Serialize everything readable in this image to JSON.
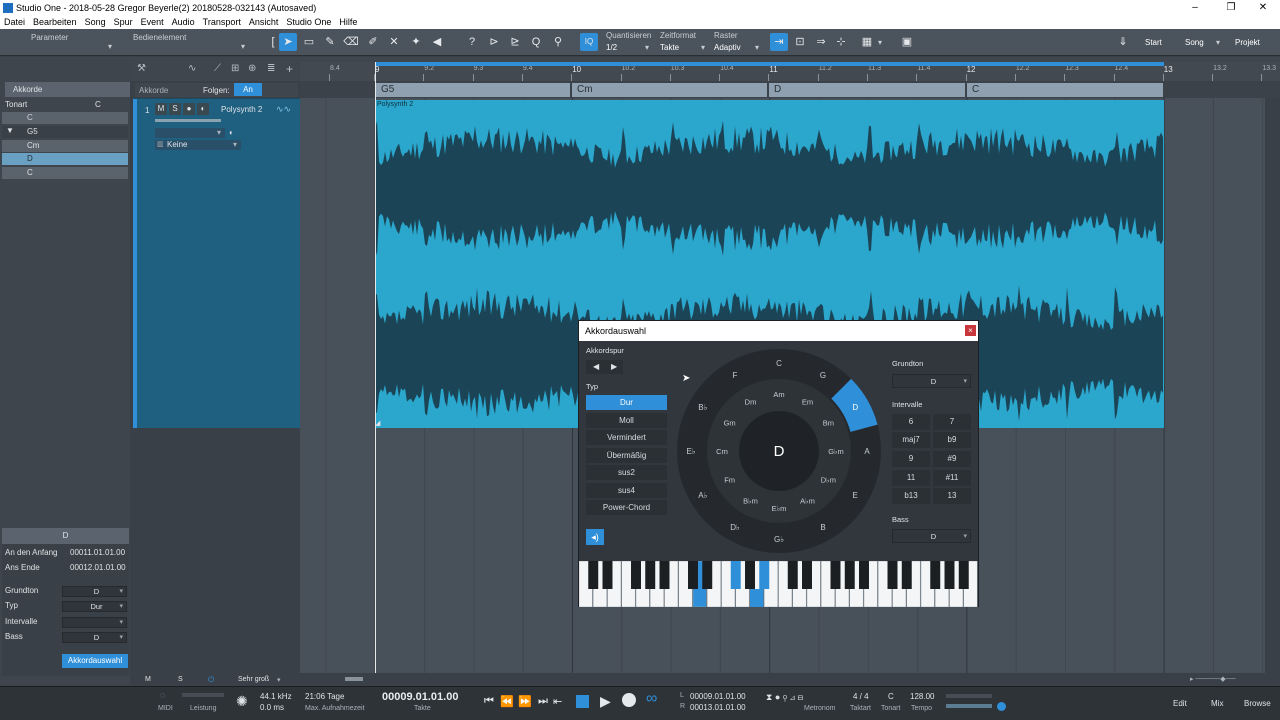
{
  "window": {
    "title": "Studio One - 2018-05-28 Gregor Beyerle(2) 20180528-032143 (Autosaved)",
    "controls": [
      "–",
      "❐",
      "✕"
    ]
  },
  "menu": [
    "Datei",
    "Bearbeiten",
    "Song",
    "Spur",
    "Event",
    "Audio",
    "Transport",
    "Ansicht",
    "Studio One",
    "Hilfe"
  ],
  "toolbar": {
    "parameter_label": "Parameter",
    "control_label": "Bedienelement",
    "quantize": {
      "label": "Quantisieren",
      "value": "1/2"
    },
    "timeformat": {
      "label": "Zeitformat",
      "value": "Takte"
    },
    "grid": {
      "label": "Raster",
      "value": "Adaptiv"
    },
    "iq_label": "IQ",
    "nav": {
      "start": "Start",
      "song": "Song",
      "project": "Projekt"
    }
  },
  "left": {
    "chords_tab": "Akkorde",
    "follow_label": "Folgen:",
    "follow_value": "An",
    "key_label": "Tonart",
    "key_value": "C",
    "chord_list": [
      "C",
      "G5",
      "Cm",
      "D",
      "C"
    ]
  },
  "track": {
    "number": "1",
    "buttons": [
      "M",
      "S",
      "●",
      "◐"
    ],
    "name": "Polysynth 2",
    "input": "Keine"
  },
  "ruler": {
    "labels": [
      "8.4",
      "9",
      "9.2",
      "9.3",
      "9.4",
      "10",
      "10.2",
      "10.3",
      "10.4",
      "11",
      "11.2",
      "11.3",
      "11.4",
      "12",
      "12.2",
      "12.3",
      "12.4",
      "13",
      "13.2",
      "13.3"
    ]
  },
  "chord_track": {
    "segments": [
      "G5",
      "Cm",
      "D",
      "C"
    ]
  },
  "event": {
    "name": "Polysynth 2"
  },
  "inspector": {
    "chord_name": "D",
    "start_label": "An den Anfang",
    "start_value": "00011.01.01.00",
    "end_label": "Ans Ende",
    "end_value": "00012.01.01.00",
    "root_label": "Grundton",
    "root_value": "D",
    "type_label": "Typ",
    "type_value": "Dur",
    "intervals_label": "Intervalle",
    "intervals_value": "",
    "bass_label": "Bass",
    "bass_value": "D",
    "chord_select_button": "Akkordauswahl"
  },
  "bottom_bar": {
    "m": "M",
    "s": "S",
    "zoom": "Sehr groß"
  },
  "dialog": {
    "title": "Akkordauswahl",
    "close": "×",
    "chord_track_label": "Akkordspur",
    "type_label": "Typ",
    "types": [
      "Dur",
      "Moll",
      "Vermindert",
      "Übermäßig",
      "sus2",
      "sus4",
      "Power-Chord"
    ],
    "selected_type": "Dur",
    "root_label": "Grundton",
    "root_value": "D",
    "intervals_label": "Intervalle",
    "intervals": [
      "6",
      "7",
      "maj7",
      "b9",
      "9",
      "#9",
      "11",
      "#11",
      "b13",
      "13"
    ],
    "bass_label": "Bass",
    "bass_value": "D",
    "center_chord": "D",
    "outer_ring": [
      "C",
      "G",
      "D",
      "A",
      "E",
      "B",
      "G♭",
      "D♭",
      "A♭",
      "E♭",
      "B♭",
      "F"
    ],
    "middle_ring": [
      "Am",
      "Em",
      "Bm",
      "G♭m",
      "D♭m",
      "A♭m",
      "E♭m",
      "B♭m",
      "Fm",
      "Cm",
      "Gm",
      "Dm"
    ],
    "highlighted_outer": "D"
  },
  "transport": {
    "midi_label": "MIDI",
    "perf_label": "Leistung",
    "samplerate": "44.1 kHz",
    "latency": "0.0 ms",
    "rec_time": "21:06 Tage",
    "rec_time_label": "Max. Aufnahmezeit",
    "position": "00009.01.01.00",
    "position_label": "Takte",
    "loop_l": "00009.01.01.00",
    "loop_r": "00013.01.01.00",
    "metronome_label": "Metronom",
    "signature": "4 / 4",
    "signature_label": "Taktart",
    "key": "C",
    "key_label": "Tonart",
    "tempo": "128.00",
    "tempo_label": "Tempo",
    "views": [
      "Edit",
      "Mix",
      "Browse"
    ]
  },
  "colors": {
    "accent": "#2f8fd8",
    "wave": "#2ba6cd",
    "waveform": "#1b4556"
  }
}
